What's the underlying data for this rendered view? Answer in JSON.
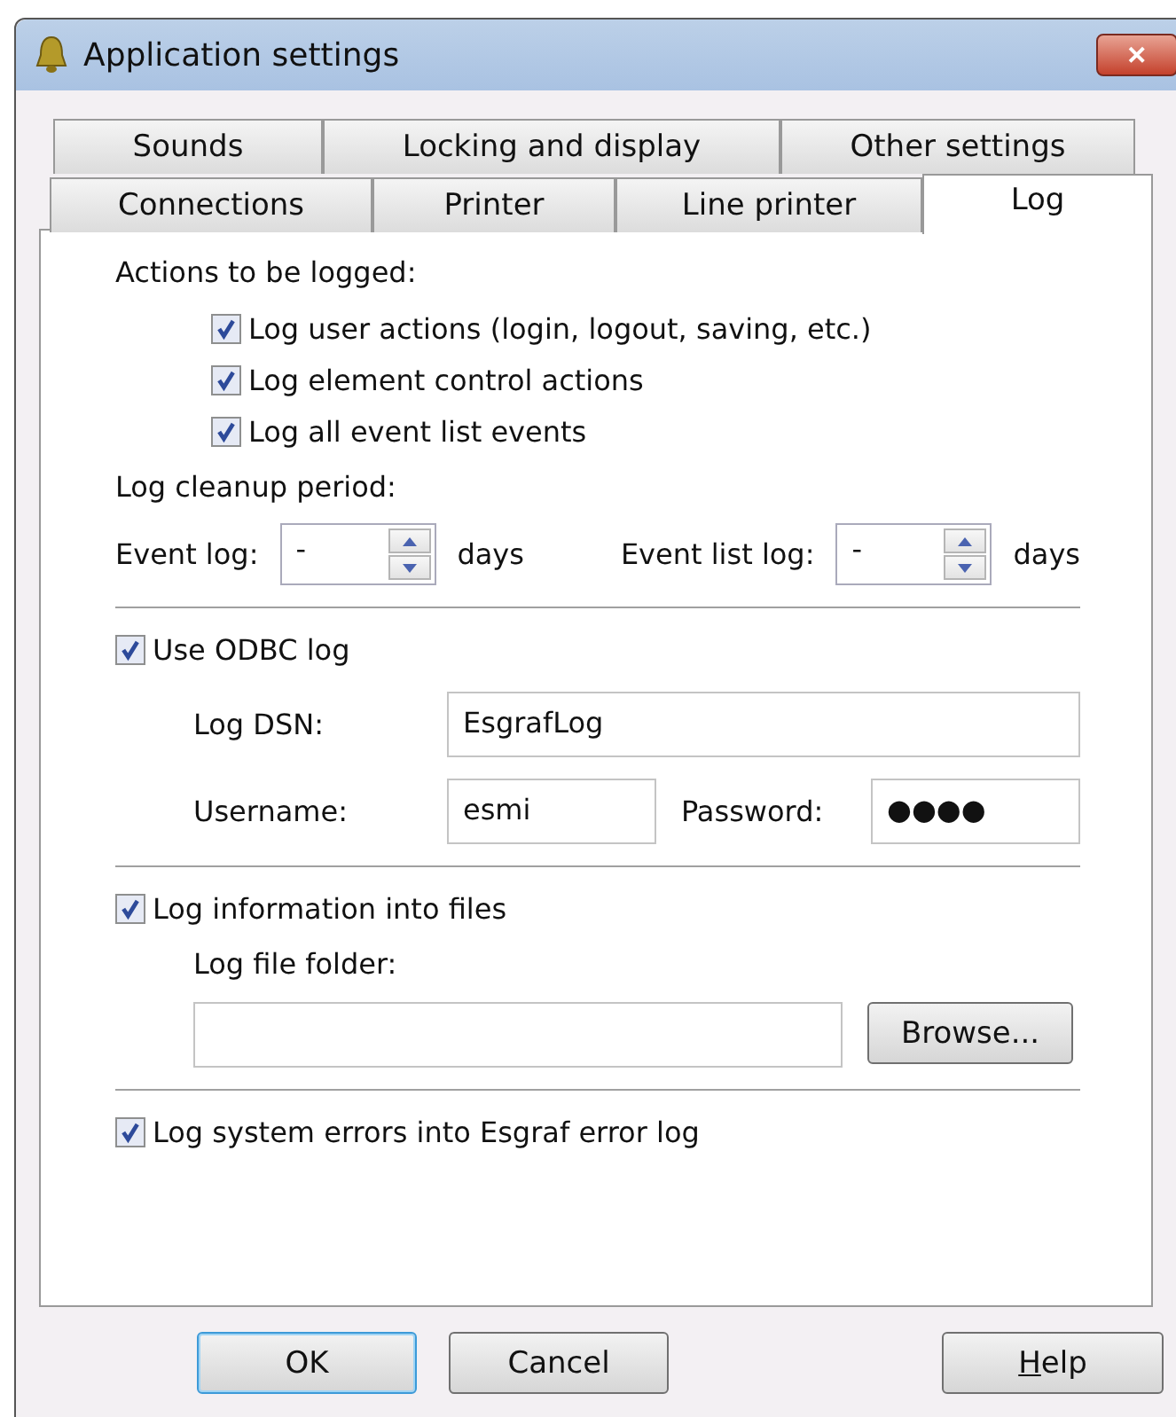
{
  "window": {
    "title": "Application settings",
    "close_label": "✕"
  },
  "tab_rows": [
    {
      "tabs": [
        {
          "label": "Sounds",
          "selected": false
        },
        {
          "label": "Locking and display",
          "selected": false
        },
        {
          "label": "Other settings",
          "selected": false
        }
      ]
    },
    {
      "tabs": [
        {
          "label": "Connections",
          "selected": false
        },
        {
          "label": "Printer",
          "selected": false
        },
        {
          "label": "Line printer",
          "selected": false
        },
        {
          "label": "Log",
          "selected": true
        }
      ]
    }
  ],
  "actions": {
    "heading": "Actions to be logged:",
    "options": [
      {
        "label": "Log user actions (login, logout, saving, etc.)",
        "checked": true
      },
      {
        "label": "Log element control actions",
        "checked": true
      },
      {
        "label": "Log all event list events",
        "checked": true
      }
    ]
  },
  "cleanup": {
    "heading": "Log cleanup period:",
    "spinners": [
      {
        "label": "Event log:",
        "value": "-",
        "unit": "days"
      },
      {
        "label": "Event list log:",
        "value": "-",
        "unit": "days"
      }
    ]
  },
  "odbc": {
    "label": "Use ODBC log",
    "checked": true,
    "dsn_label": "Log DSN:",
    "dsn": "EsgrafLog",
    "username_label": "Username:",
    "username": "esmi",
    "password_label": "Password:",
    "password": "●●●●"
  },
  "files": {
    "label": "Log information into files",
    "checked": true,
    "folder_label": "Log file folder:",
    "browse": "Browse..."
  },
  "errors": {
    "label": "Log system errors into Esgraf error log",
    "checked": true
  },
  "buttons": [
    {
      "label": "OK",
      "kind": "default"
    },
    {
      "label": "Cancel",
      "kind": "normal"
    },
    {
      "label": "Help",
      "kind": "mnemonic"
    }
  ]
}
